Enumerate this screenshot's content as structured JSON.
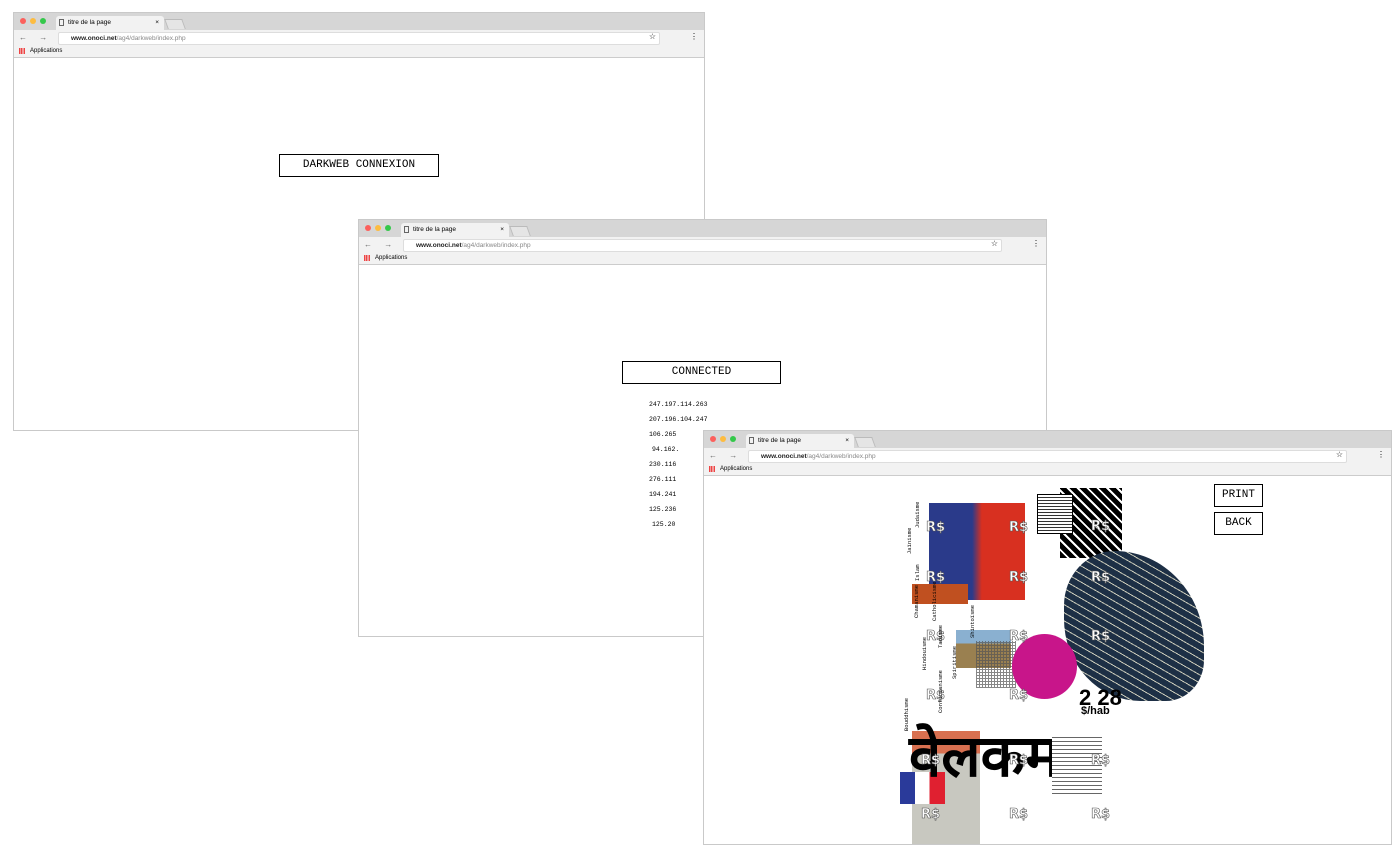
{
  "browser": {
    "tab_title": "titre de la page",
    "url_domain": "www.onoci.net",
    "url_path": "/ag4/darkweb/index.php",
    "bookmark": "Applications",
    "close": "×",
    "nav": "← → C",
    "star": "☆",
    "menu": "⋮"
  },
  "window1": {
    "button": "DARKWEB CONNEXION"
  },
  "window2": {
    "status": "CONNECTED",
    "ips": [
      "247.197.114.263",
      "207.196.104.247",
      "106.265",
      "94.162.",
      "230.116",
      "276.111",
      "194.241",
      "125.236",
      "125.20"
    ]
  },
  "window3": {
    "print": "PRINT",
    "back": "BACK",
    "price": "2 28",
    "unit": "$/hab",
    "currency": "R$",
    "title": "वेलकम",
    "religions": [
      "Judaïsme",
      "Jaïnisme",
      "Islam",
      "Chamanisme",
      "Catholicisme",
      "Hindouisme",
      "Taoïsme",
      "Spiritisme",
      "Shintoïsme",
      "Confucianisme",
      "Bouddhisme"
    ]
  },
  "colors": {
    "magenta": "#c8158a",
    "navy": "#1d2f45",
    "red": "#e03a2a",
    "flag_blue": "#2a3a9a",
    "flag_red": "#e02030"
  }
}
